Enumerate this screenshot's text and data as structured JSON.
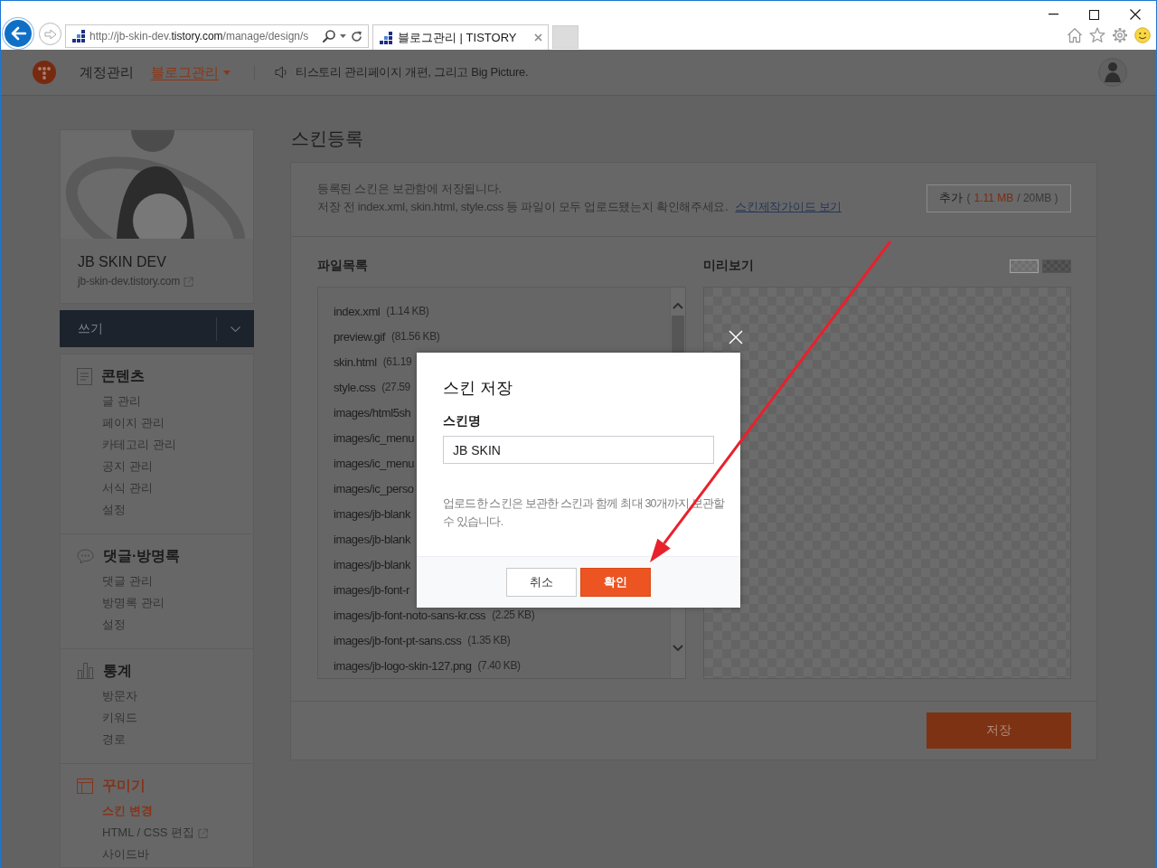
{
  "browser": {
    "address": [
      {
        "text": "http://jb-skin-dev.",
        "kind": "dim"
      },
      {
        "text": "tistory.com",
        "kind": "domain"
      },
      {
        "text": "/manage/design/s",
        "kind": "dim"
      }
    ],
    "tabs": [
      {
        "title": "블로그관리 | TISTORY",
        "selected": true
      }
    ]
  },
  "header": {
    "nav": [
      {
        "label": "계정관리",
        "selected": false
      },
      {
        "label": "블로그관리",
        "selected": true
      }
    ],
    "notice": "티스토리 관리페이지 개편, 그리고 Big Picture."
  },
  "sidebar": {
    "blog_title": "JB SKIN DEV",
    "blog_url": "jb-skin-dev.tistory.com",
    "write_button": "쓰기",
    "sections": [
      {
        "kind": "contents",
        "title": "콘텐츠",
        "selected": false,
        "items": [
          {
            "label": "글 관리",
            "selected": false,
            "external": false
          },
          {
            "label": "페이지 관리",
            "selected": false,
            "external": false
          },
          {
            "label": "카테고리 관리",
            "selected": false,
            "external": false
          },
          {
            "label": "공지 관리",
            "selected": false,
            "external": false
          },
          {
            "label": "서식 관리",
            "selected": false,
            "external": false
          },
          {
            "label": "설정",
            "selected": false,
            "external": false
          }
        ]
      },
      {
        "kind": "comments",
        "title": "댓글·방명록",
        "selected": false,
        "items": [
          {
            "label": "댓글 관리",
            "selected": false,
            "external": false
          },
          {
            "label": "방명록 관리",
            "selected": false,
            "external": false
          },
          {
            "label": "설정",
            "selected": false,
            "external": false
          }
        ]
      },
      {
        "kind": "stats",
        "title": "통계",
        "selected": false,
        "items": [
          {
            "label": "방문자",
            "selected": false,
            "external": false
          },
          {
            "label": "키워드",
            "selected": false,
            "external": false
          },
          {
            "label": "경로",
            "selected": false,
            "external": false
          }
        ]
      },
      {
        "kind": "design",
        "title": "꾸미기",
        "selected": true,
        "items": [
          {
            "label": "스킨 변경",
            "selected": true,
            "external": false
          },
          {
            "label": "HTML / CSS 편집",
            "selected": false,
            "external": true
          },
          {
            "label": "사이드바",
            "selected": false,
            "external": false
          }
        ]
      }
    ]
  },
  "main": {
    "title": "스킨등록",
    "info_lines": [
      "등록된 스킨은 보관함에 저장됩니다.",
      "저장 전 index.xml, skin.html, style.css 등 파일이 모두 업로드됐는지 확인해주세요."
    ],
    "guide_link": "스킨제작가이드 보기",
    "add_button": {
      "label": "추가",
      "usage": [
        {
          "text": "(",
          "kind": "plain"
        },
        {
          "text": "1.11 MB",
          "kind": "used"
        },
        {
          "text": "/ 20MB )",
          "kind": "plain"
        }
      ]
    },
    "file_list": {
      "title": "파일목록",
      "files": [
        {
          "name": "index.xml",
          "size": "(1.14 KB)"
        },
        {
          "name": "preview.gif",
          "size": "(81.56 KB)"
        },
        {
          "name": "skin.html",
          "size": "(61.19"
        },
        {
          "name": "style.css",
          "size": "(27.59"
        },
        {
          "name": "images/html5sh"
        },
        {
          "name": "images/ic_menu"
        },
        {
          "name": "images/ic_menu"
        },
        {
          "name": "images/ic_perso"
        },
        {
          "name": "images/jb-blank"
        },
        {
          "name": "images/jb-blank"
        },
        {
          "name": "images/jb-blank"
        },
        {
          "name": "images/jb-font-r"
        },
        {
          "name": "images/jb-font-noto-sans-kr.css",
          "size": "(2.25 KB)"
        },
        {
          "name": "images/jb-font-pt-sans.css",
          "size": "(1.35 KB)"
        },
        {
          "name": "images/jb-logo-skin-127.png",
          "size": "(7.40 KB)"
        }
      ]
    },
    "preview": {
      "title": "미리보기",
      "backgrounds": [
        {
          "kind": "light",
          "selected": true
        },
        {
          "kind": "dark",
          "selected": false
        }
      ]
    },
    "save_button": "저장"
  },
  "modal": {
    "title": "스킨 저장",
    "field_label": "스킨명",
    "field_value": "JB SKIN",
    "note": "업로드한 스킨은 보관한 스킨과 함께 최대 30개까지 보관할 수 있습니다.",
    "buttons": [
      {
        "label": "취소",
        "kind": "secondary"
      },
      {
        "label": "확인",
        "kind": "primary"
      }
    ]
  }
}
